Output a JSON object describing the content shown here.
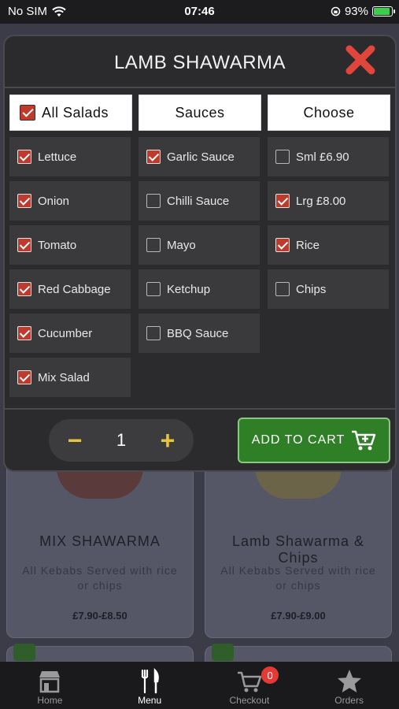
{
  "status_bar": {
    "carrier": "No SIM",
    "time": "07:46",
    "battery": "93%",
    "battery_level": 0.93
  },
  "background_menu": {
    "cards": [
      {
        "name": "MIX SHAWARMA",
        "description": "All Kebabs Served with rice or chips",
        "price": "£7.90-£8.50"
      },
      {
        "name": "Lamb Shawarma & Chips",
        "description": "All Kebabs Served with rice or chips",
        "price": "£7.90-£9.00"
      }
    ]
  },
  "modal": {
    "title": "LAMB SHAWARMA",
    "columns": [
      {
        "header": "All Salads",
        "header_checked": true,
        "options": [
          {
            "label": "Lettuce",
            "checked": true
          },
          {
            "label": "Onion",
            "checked": true
          },
          {
            "label": "Tomato",
            "checked": true
          },
          {
            "label": "Red Cabbage",
            "checked": true
          },
          {
            "label": "Cucumber",
            "checked": true
          },
          {
            "label": "Mix Salad",
            "checked": true
          }
        ]
      },
      {
        "header": "Sauces",
        "options": [
          {
            "label": "Garlic Sauce",
            "checked": true
          },
          {
            "label": "Chilli Sauce",
            "checked": false
          },
          {
            "label": "Mayo",
            "checked": false
          },
          {
            "label": "Ketchup",
            "checked": false
          },
          {
            "label": "BBQ Sauce",
            "checked": false
          }
        ]
      },
      {
        "header": "Choose",
        "options": [
          {
            "label": "Sml £6.90",
            "checked": false
          },
          {
            "label": "Lrg £8.00",
            "checked": true
          },
          {
            "label": "Rice",
            "checked": true
          },
          {
            "label": "Chips",
            "checked": false
          }
        ]
      }
    ],
    "quantity": "1",
    "minus": "−",
    "plus": "+",
    "add_to_cart": "ADD TO CART"
  },
  "tab_bar": {
    "tabs": [
      {
        "label": "Home",
        "icon": "store-icon",
        "active": false
      },
      {
        "label": "Menu",
        "icon": "fork-knife-icon",
        "active": true
      },
      {
        "label": "Checkout",
        "icon": "cart-icon",
        "active": false,
        "badge": "0"
      },
      {
        "label": "Orders",
        "icon": "star-icon",
        "active": false
      }
    ]
  },
  "colors": {
    "accent_green": "#2f7f26",
    "check_red": "#c0392b",
    "stepper_yellow": "#e8c33c",
    "close_red": "#e0463b"
  }
}
